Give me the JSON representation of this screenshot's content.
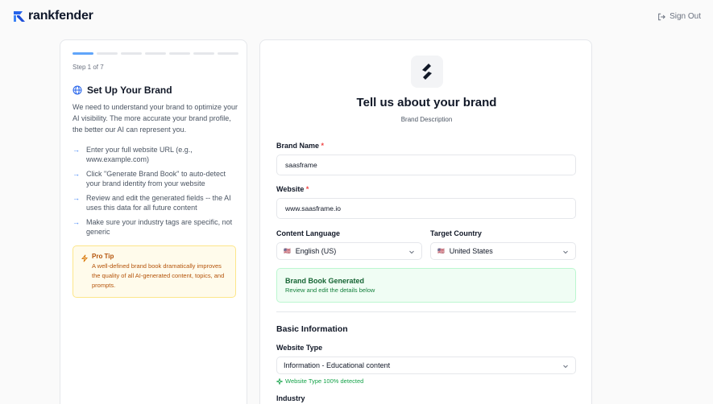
{
  "header": {
    "logo_text": "rankfender",
    "sign_out_label": "Sign Out"
  },
  "sidebar": {
    "progress": {
      "current": 1,
      "total": 7
    },
    "step_label": "Step 1 of 7",
    "title": "Set Up Your Brand",
    "description": "We need to understand your brand to optimize your AI visibility. The more accurate your brand profile, the better our AI can represent you.",
    "tips": [
      "Enter your full website URL (e.g., www.example.com)",
      "Click \"Generate Brand Book\" to auto-detect your brand identity from your website",
      "Review and edit the generated fields -- the AI uses this data for all future content",
      "Make sure your industry tags are specific, not generic"
    ],
    "pro_tip": {
      "title": "Pro Tip",
      "text": "A well-defined brand book dramatically improves the quality of all AI-generated content, topics, and prompts."
    }
  },
  "main": {
    "title": "Tell us about your brand",
    "subtitle": "Brand Description",
    "brand_name": {
      "label": "Brand Name",
      "required": "*",
      "value": "saasframe"
    },
    "website": {
      "label": "Website",
      "required": "*",
      "value": "www.saasframe.io"
    },
    "content_language": {
      "label": "Content Language",
      "flag": "🇺🇸",
      "value": "English (US)"
    },
    "target_country": {
      "label": "Target Country",
      "flag": "🇺🇸",
      "value": "United States"
    },
    "success_banner": {
      "title": "Brand Book Generated",
      "subtitle": "Review and edit the details below"
    },
    "section_title": "Basic Information",
    "website_type": {
      "label": "Website Type",
      "value": "Information - Educational content",
      "detected": "Website Type 100% detected"
    },
    "industry": {
      "label": "Industry"
    }
  },
  "colors": {
    "accent": "#60a5fa",
    "success_bg": "#f0fdf4",
    "warning_bg": "#fffbeb",
    "required": "#ef4444"
  }
}
